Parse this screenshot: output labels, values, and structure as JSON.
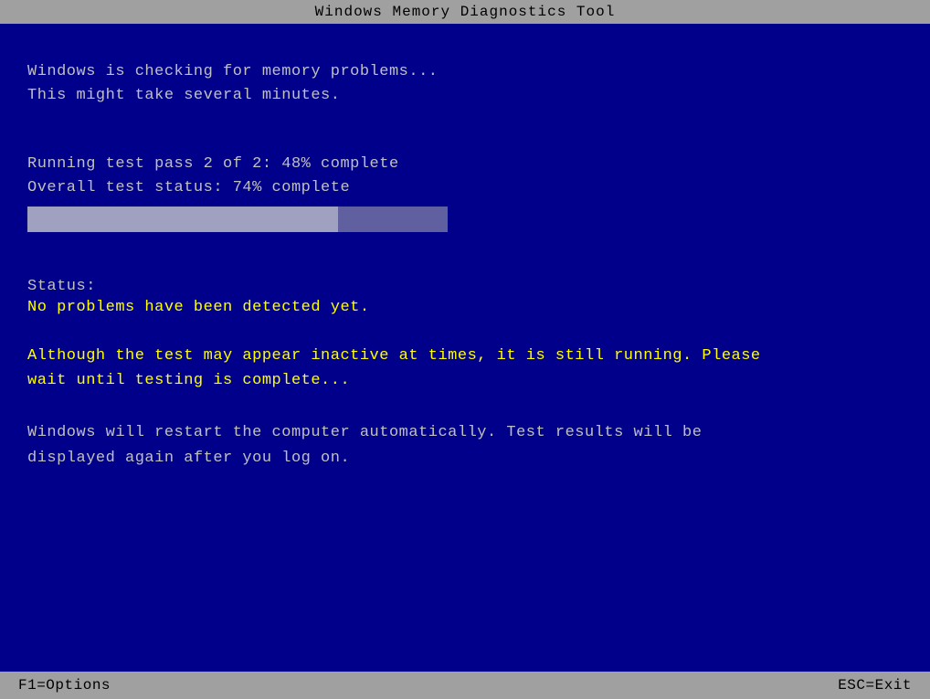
{
  "titleBar": {
    "label": "Windows Memory Diagnostics Tool"
  },
  "mainContent": {
    "line1": "Windows is checking for memory problems...",
    "line2": "This might take several minutes.",
    "progressLine1": "Running test pass  2 of  2: 48% complete",
    "progressLine2": "Overall test status: 74% complete",
    "progressPercent": 74,
    "statusLabel": "Status:",
    "statusValue": "No problems have been detected yet.",
    "warningLine1": "Although the test may appear inactive at times, it is still running. Please",
    "warningLine2": "wait until testing is complete...",
    "infoLine1": "Windows will restart the computer automatically. Test results will be",
    "infoLine2": "displayed again after you log on."
  },
  "bottomBar": {
    "leftLabel": "F1=Options",
    "rightLabel": "ESC=Exit"
  }
}
